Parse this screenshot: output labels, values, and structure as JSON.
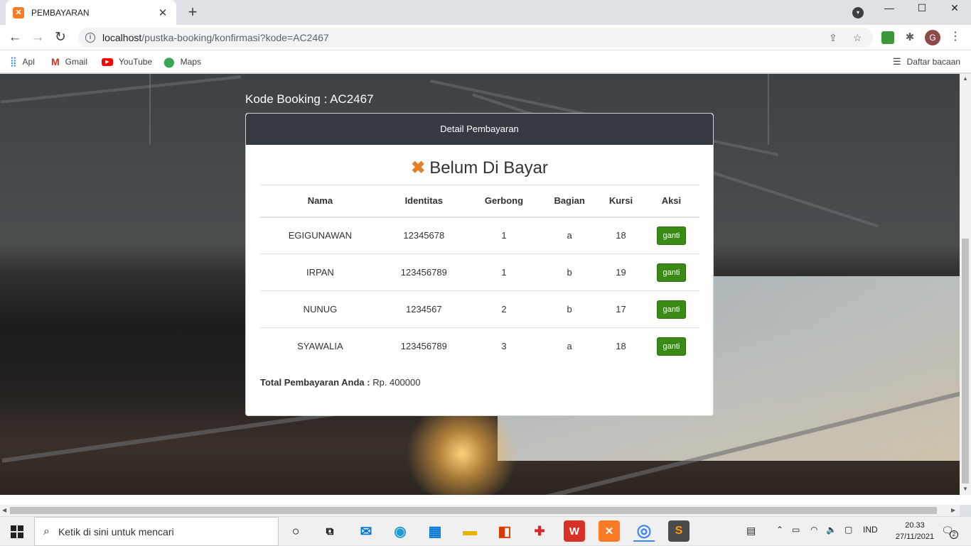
{
  "browser": {
    "tab_title": "PEMBAYARAN",
    "tab_close": "✕",
    "new_tab": "+",
    "url_host": "localhost",
    "url_path": "/pustka-booking/konfirmasi?kode=AC2467",
    "bookmarks": [
      {
        "label": "Apl",
        "icon": "apps-grid-icon"
      },
      {
        "label": "Gmail",
        "icon": "gmail-icon"
      },
      {
        "label": "YouTube",
        "icon": "youtube-icon"
      },
      {
        "label": "Maps",
        "icon": "maps-icon"
      }
    ],
    "reading_list": "Daftar bacaan",
    "profile_initial": "G"
  },
  "booking": {
    "code_label": "Kode Booking : AC2467",
    "card_title": "Detail Pembayaran",
    "status_icon": "✖",
    "status_text": "Belum Di Bayar",
    "columns": [
      "Nama",
      "Identitas",
      "Gerbong",
      "Bagian",
      "Kursi",
      "Aksi"
    ],
    "rows": [
      {
        "nama": "EGIGUNAWAN",
        "identitas": "12345678",
        "gerbong": "1",
        "bagian": "a",
        "kursi": "18",
        "aksi": "ganti"
      },
      {
        "nama": "IRPAN",
        "identitas": "123456789",
        "gerbong": "1",
        "bagian": "b",
        "kursi": "19",
        "aksi": "ganti"
      },
      {
        "nama": "NUNUG",
        "identitas": "1234567",
        "gerbong": "2",
        "bagian": "b",
        "kursi": "17",
        "aksi": "ganti"
      },
      {
        "nama": "SYAWALIA",
        "identitas": "123456789",
        "gerbong": "3",
        "bagian": "a",
        "kursi": "18",
        "aksi": "ganti"
      }
    ],
    "total_label": "Total Pembayaran Anda :",
    "total_value": "Rp. 400000"
  },
  "taskbar": {
    "search_placeholder": "Ketik di sini untuk mencari",
    "language": "IND",
    "time": "20.33",
    "date": "27/11/2021",
    "notification_count": "2"
  },
  "colors": {
    "card_header": "#343a40",
    "status_icon": "#e67e22",
    "button": "#3a8a16"
  }
}
